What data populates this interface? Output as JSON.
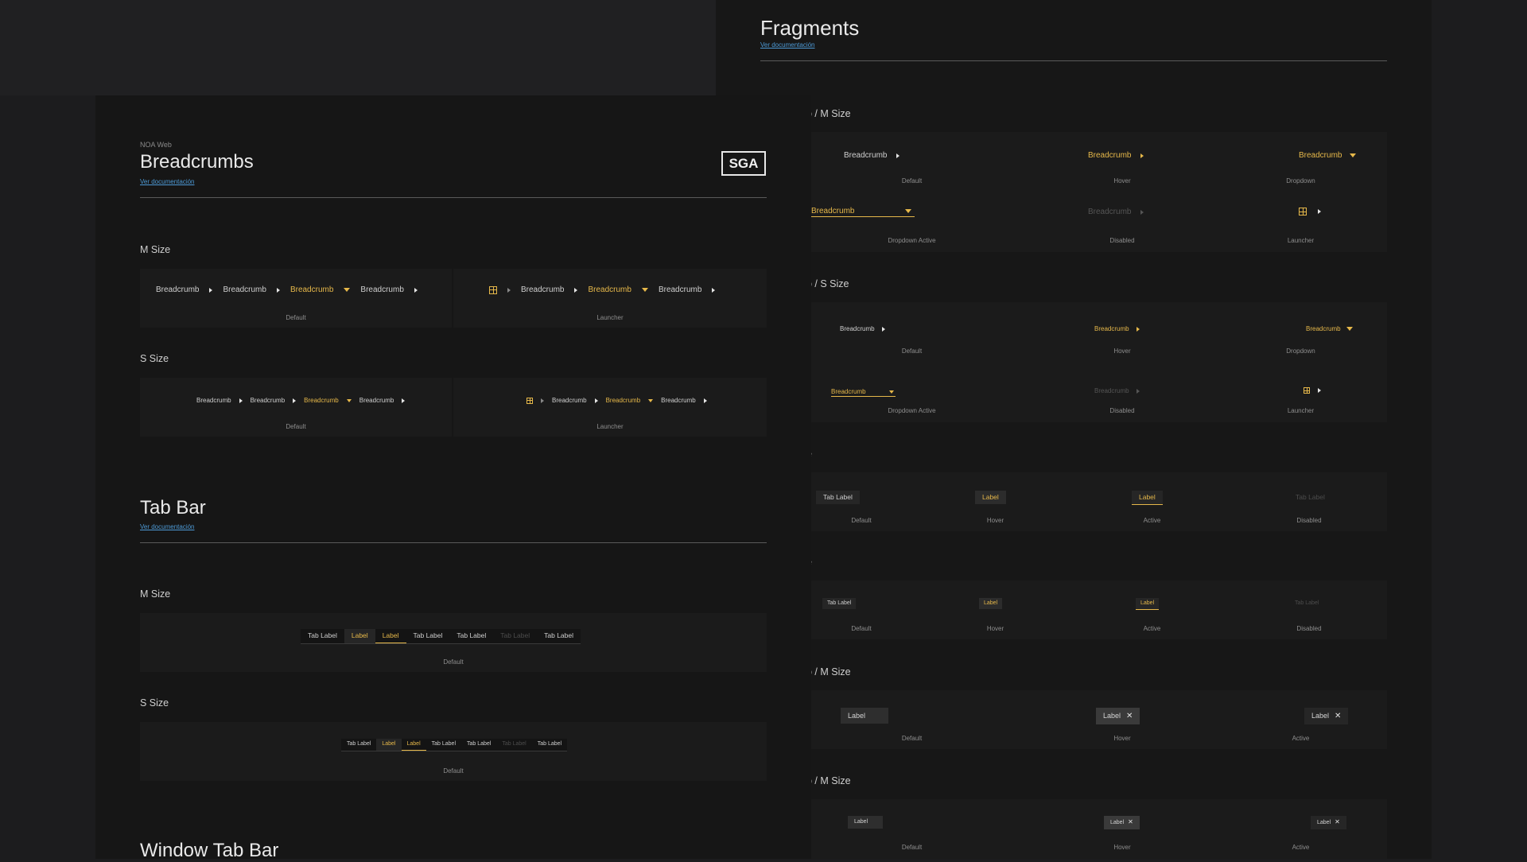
{
  "colors": {
    "accent": "#e6b84a",
    "link": "#4d9ad6"
  },
  "left": {
    "subtitle": "NOA Web",
    "title": "Breadcrumbs",
    "doc_link": "Ver documentación",
    "logo": "SGA",
    "m_size": "M Size",
    "s_size": "S Size",
    "bc": "Breadcrumb",
    "default": "Default",
    "launcher": "Launcher",
    "tab_title": "Tab Bar",
    "tab_doc": "Ver documentación",
    "tab_m": "M Size",
    "tab_s": "S Size",
    "tabs": [
      "Tab Label",
      "Label",
      "Label",
      "Tab Label",
      "Tab Label",
      "Tab Label",
      "Tab Label"
    ],
    "window_title": "Window Tab Bar"
  },
  "right": {
    "title": "Fragments",
    "doc_link": "Ver documentación",
    "sec1": "p / M Size",
    "sec2": "p / S Size",
    "sec3": "e",
    "sec4": "e",
    "sec5": "p / M Size",
    "sec6": "p / M Size",
    "bc": "Breadcrumb",
    "states": {
      "default": "Default",
      "hover": "Hover",
      "dropdown": "Dropdown",
      "dropdown_active": "Dropdown Active",
      "disabled": "Disabled",
      "launcher": "Launcher",
      "active": "Active"
    },
    "tab_label": "Tab Label",
    "label": "Label"
  }
}
